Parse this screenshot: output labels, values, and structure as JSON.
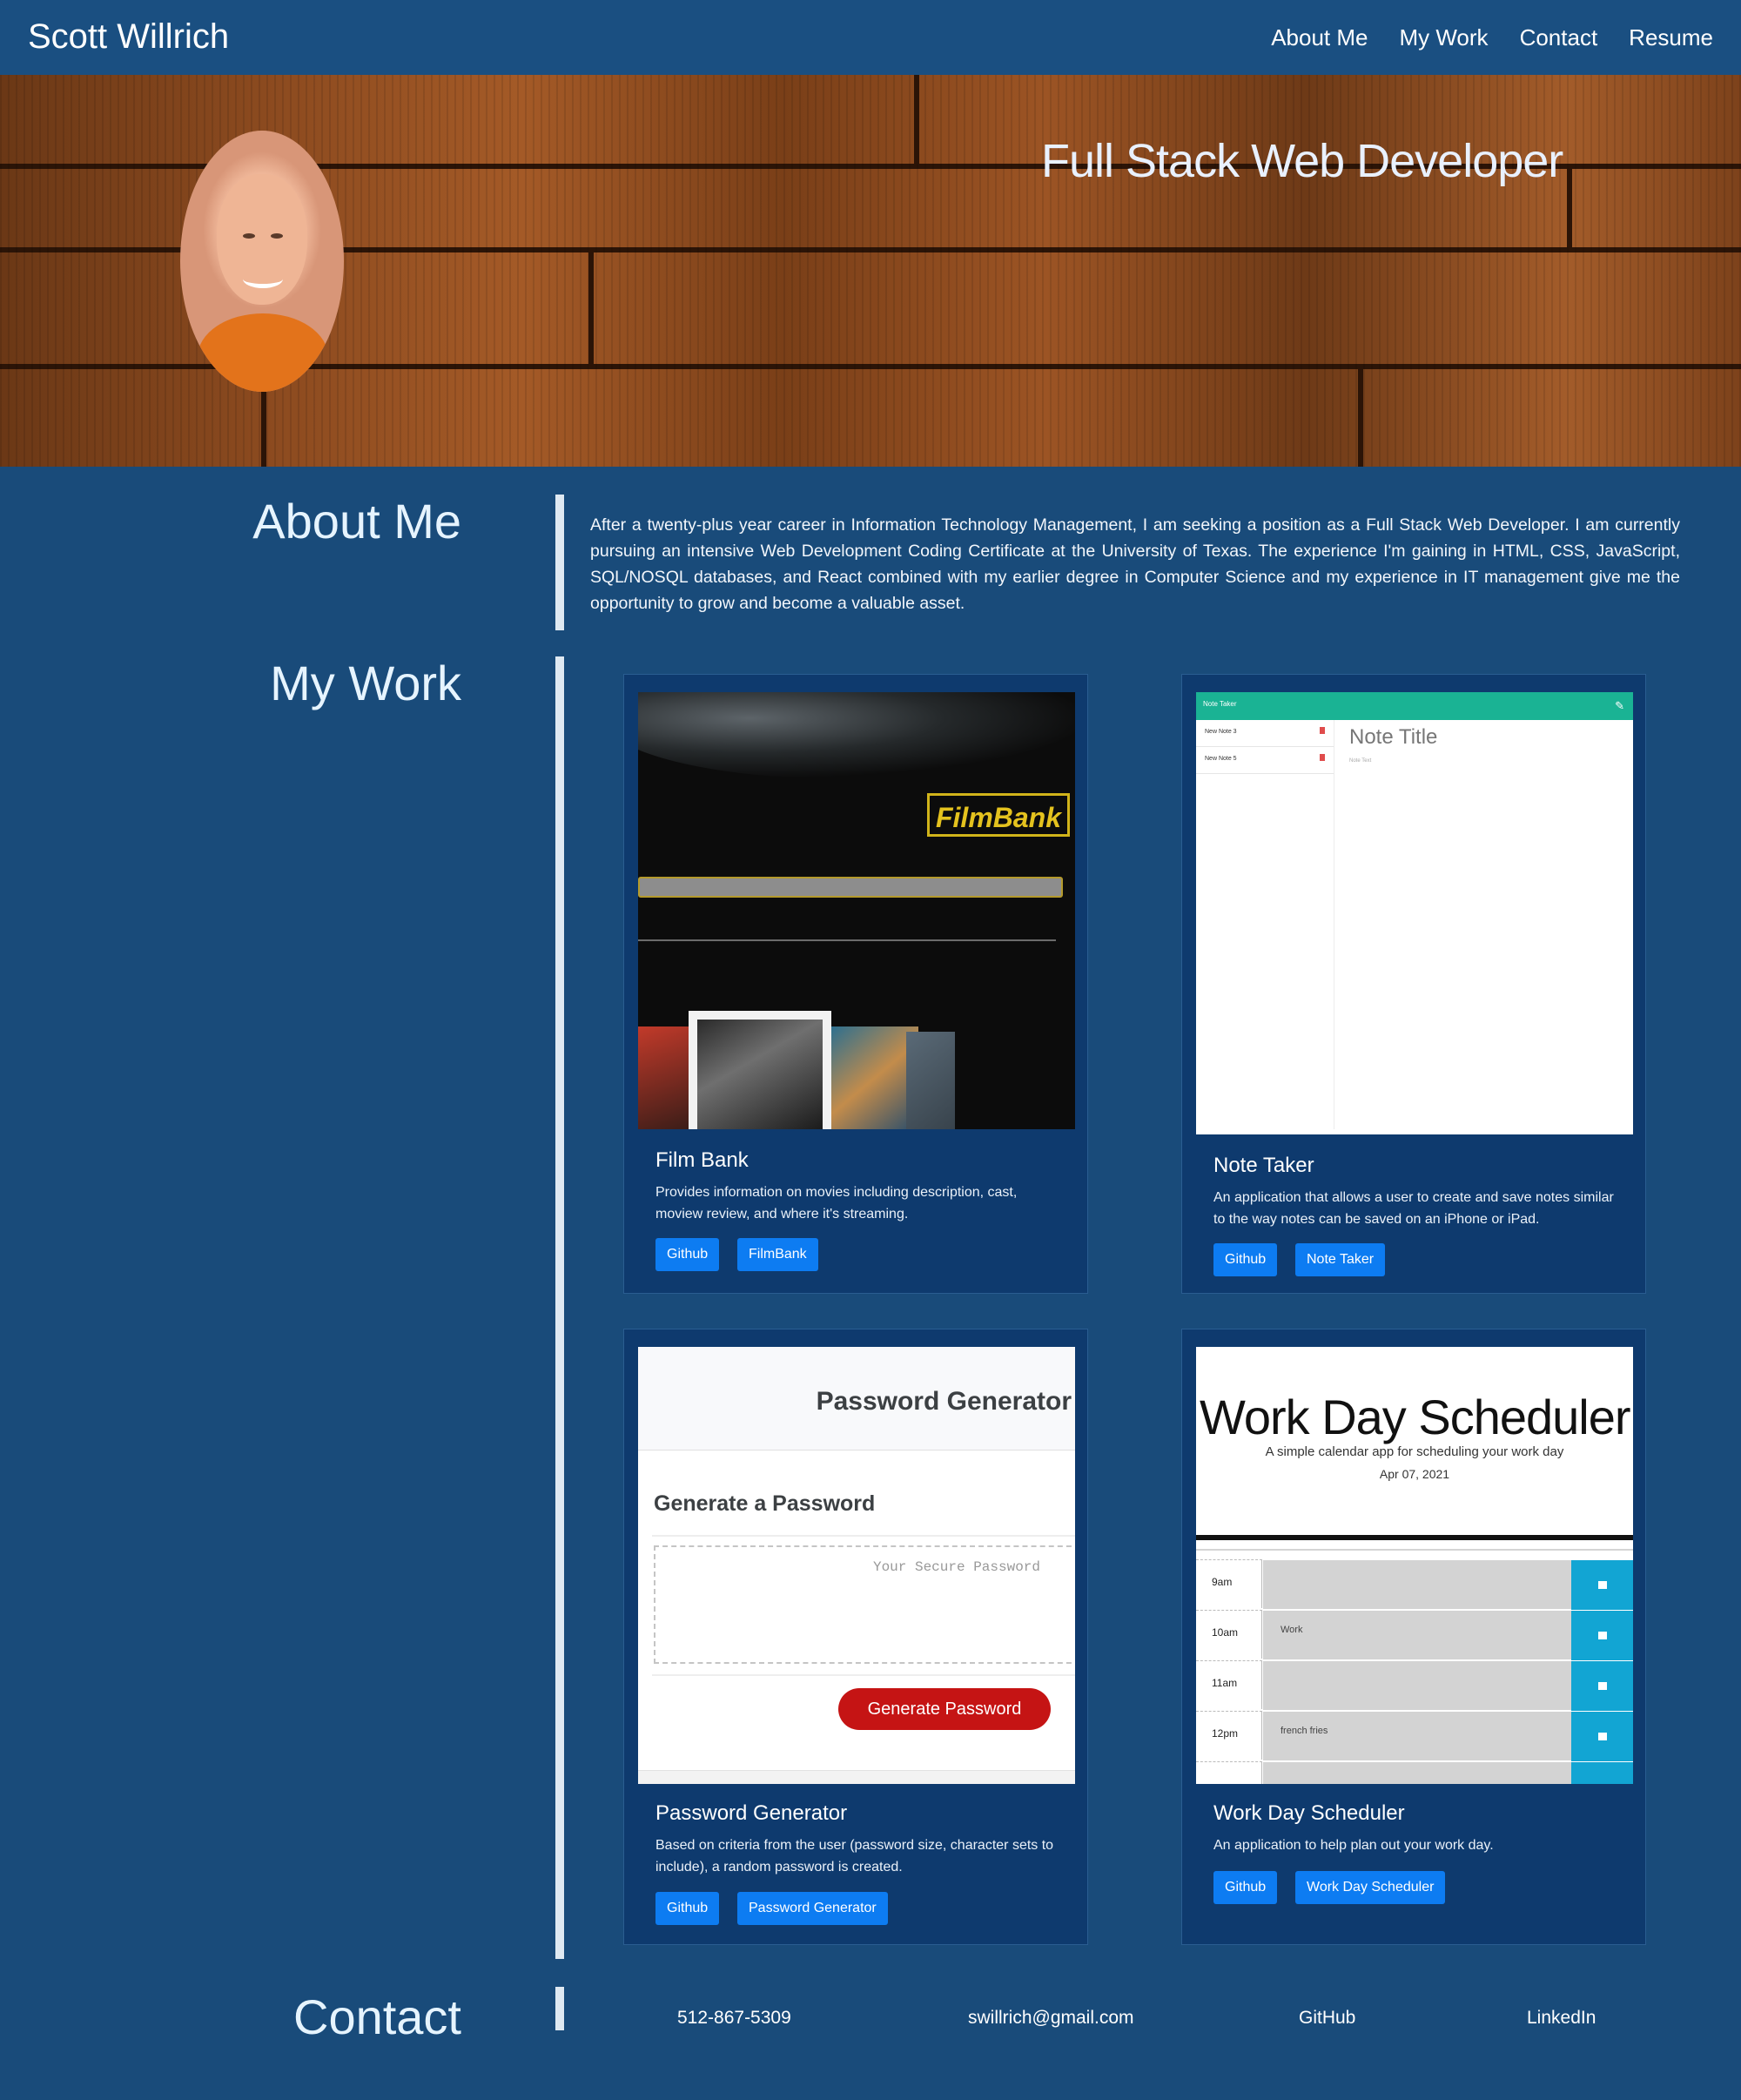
{
  "nav": {
    "brand": "Scott Willrich",
    "links": [
      "About Me",
      "My Work",
      "Contact",
      "Resume"
    ]
  },
  "hero": {
    "title": "Full Stack Web Developer"
  },
  "about": {
    "heading": "About Me",
    "text": "After a twenty-plus year career in Information Technology Management, I am seeking a position as a Full Stack Web Developer. I am currently pursuing an intensive Web Development Coding Certificate at the University of Texas. The experience I'm gaining in HTML, CSS, JavaScript, SQL/NOSQL databases, and React combined with my earlier degree in Computer Science and my experience in IT management give me the opportunity to grow and become a valuable asset."
  },
  "work": {
    "heading": "My Work",
    "projects": [
      {
        "title": "Film Bank",
        "description": "Provides information on movies including description, cast, moview review, and where it's streaming.",
        "buttons": [
          "Github",
          "FilmBank"
        ],
        "screenshot": {
          "logo": "FilmBank"
        }
      },
      {
        "title": "Note Taker",
        "description": "An application that allows a user to create and save notes similar to the way notes can be saved on an iPhone or iPad.",
        "buttons": [
          "Github",
          "Note Taker"
        ],
        "screenshot": {
          "header": "Note Taker",
          "notes": [
            "New Note 3",
            "New Note 5"
          ],
          "note_title": "Note Title",
          "note_text": "Note Text"
        }
      },
      {
        "title": "Password Generator",
        "description": "Based on criteria from the user (password size, character sets to include), a random password is created.",
        "buttons": [
          "Github",
          "Password Generator"
        ],
        "screenshot": {
          "header": "Password Generator",
          "subheader": "Generate a Password",
          "placeholder": "Your Secure Password",
          "button": "Generate Password"
        }
      },
      {
        "title": "Work Day Scheduler",
        "description": "An application to help plan out your work day.",
        "buttons": [
          "Github",
          "Work Day Scheduler"
        ],
        "screenshot": {
          "header": "Work Day Scheduler",
          "subheader": "A simple calendar app for scheduling your work day",
          "date": "Apr 07, 2021",
          "rows": [
            {
              "time": "9am",
              "text": ""
            },
            {
              "time": "10am",
              "text": "Work"
            },
            {
              "time": "11am",
              "text": ""
            },
            {
              "time": "12pm",
              "text": "french fries"
            }
          ]
        }
      }
    ]
  },
  "contact": {
    "heading": "Contact",
    "phone": "512-867-5309",
    "email": "swillrich@gmail.com",
    "github": "GitHub",
    "linkedin": "LinkedIn"
  },
  "colors": {
    "page_bg": "#194b7a",
    "card_bg": "#0e3a6e",
    "button": "#0d7cf2"
  }
}
